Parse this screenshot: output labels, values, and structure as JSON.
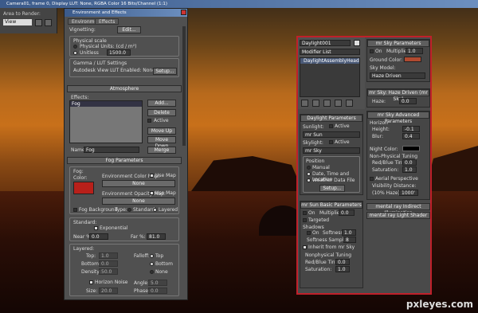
{
  "app": {
    "title": "Camera01, frame 0, Display LUT: None, RGBA Color 16 Bits/Channel (1:1)",
    "area_label": "Area to Render:",
    "area_value": "View"
  },
  "env": {
    "title": "Environment and Effects",
    "tabs": [
      "Environment",
      "Effects"
    ],
    "vignetting": "Vignetting:",
    "vignetting_val": "Edit...",
    "physcale": {
      "title": "Physical scale",
      "opt1": "Physical Units: (cd / m²)",
      "opt2": "Unitless",
      "val": "1500.0"
    },
    "gamma": {
      "title": "Gamma / LUT Settings",
      "text": "Autodesk View LUT Enabled: None",
      "btn": "Setup..."
    },
    "atmos": {
      "title": "Atmosphere",
      "effects_label": "Effects:",
      "item": "Fog",
      "add": "Add...",
      "delete": "Delete",
      "active": "Active",
      "moveup": "Move Up",
      "movedown": "Move Down",
      "name_label": "Name:",
      "name_val": "Fog",
      "merge": "Merge"
    },
    "fog": {
      "title": "Fog Parameters",
      "fog_label": "Fog:",
      "color_label": "Color:",
      "colormap": "Environment Color Map:",
      "usemap": "Use Map",
      "none": "None",
      "opacity": "Environment Opacity Map:",
      "fogbg": "Fog Background",
      "type": "Type:",
      "standard": "Standard",
      "layered": "Layered",
      "std_label": "Standard:",
      "exponential": "Exponential",
      "near": "Near %:",
      "near_val": "0.0",
      "far": "Far %:",
      "far_val": "81.0",
      "layered_label": "Layered:",
      "top": "Top:",
      "top_val": "1.0",
      "bottom": "Bottom:",
      "bottom_val": "0.0",
      "density": "Density:",
      "density_val": "50.0",
      "falloff": "Falloff:",
      "f_top": "Top",
      "f_bottom": "Bottom",
      "f_none": "None",
      "horizon": "Horizon Noise",
      "size": "Size:",
      "size_val": "20.0",
      "angle": "Angle:",
      "angle_val": "5.0",
      "phase": "Phase:",
      "phase_val": "0.0",
      "color": "#b8201a"
    }
  },
  "right": {
    "name": "Daylight001",
    "modifier": "Modifier List",
    "stack_item": "DaylightAssemblyHead",
    "daylight": {
      "title": "Daylight Parameters",
      "sunlight": "Sunlight:",
      "active": "Active",
      "sun_val": "mr Sun",
      "skylight": "Skylight:",
      "sky_val": "mr Sky",
      "position": "Position",
      "manual": "Manual",
      "datetime": "Date, Time and Location",
      "weather": "Weather Data File",
      "setup": "Setup..."
    },
    "sunbasic": {
      "title": "mr Sun Basic Parameters",
      "on": "On",
      "mult": "Multiplier:",
      "mult_val": "0.0",
      "targeted": "Targeted",
      "shadows": "Shadows",
      "s_on": "On",
      "softness": "Softness:",
      "soft_val": "1.0",
      "softsamples": "Softness Samples:",
      "samples_val": "8",
      "inherit": "Inherit from mr Sky",
      "nonphys": "Nonphysical Tuning",
      "redblue": "Red/Blue Tint:",
      "rb_val": "0.0",
      "saturation": "Saturation:",
      "sat_val": "1.0"
    },
    "sky": {
      "title": "mr Sky Parameters",
      "on": "On",
      "mult": "Multiplier:",
      "mult_val": "1.0",
      "ground": "Ground Color:",
      "ground_color": "#b04a30",
      "model": "Sky Model:",
      "model_val": "Haze Driven"
    },
    "haze": {
      "title": "mr Sky: Haze Driven (mr Sky)",
      "haze": "Haze:",
      "haze_val": "0.0"
    },
    "adv": {
      "title": "mr Sky Advanced Parameters",
      "horizon": "Horizon",
      "height": "Height:",
      "height_val": "-0.1",
      "blur": "Blur:",
      "blur_val": "0.4",
      "night": "Night Color:",
      "nonphys": "Non-Physical Tuning",
      "redblue": "Red/Blue Tint:",
      "rb_val": "0.0",
      "saturation": "Saturation:",
      "sat_val": "1.0",
      "aerial": "Aerial Perspective",
      "visdist": "Visibility Distance:",
      "visdist_label": "(10% Haze):",
      "vis_val": "1000'"
    },
    "indirect": "mental ray Indirect Illumination",
    "lightshader": "mental ray Light Shader"
  },
  "watermark": "pxleyes.com"
}
